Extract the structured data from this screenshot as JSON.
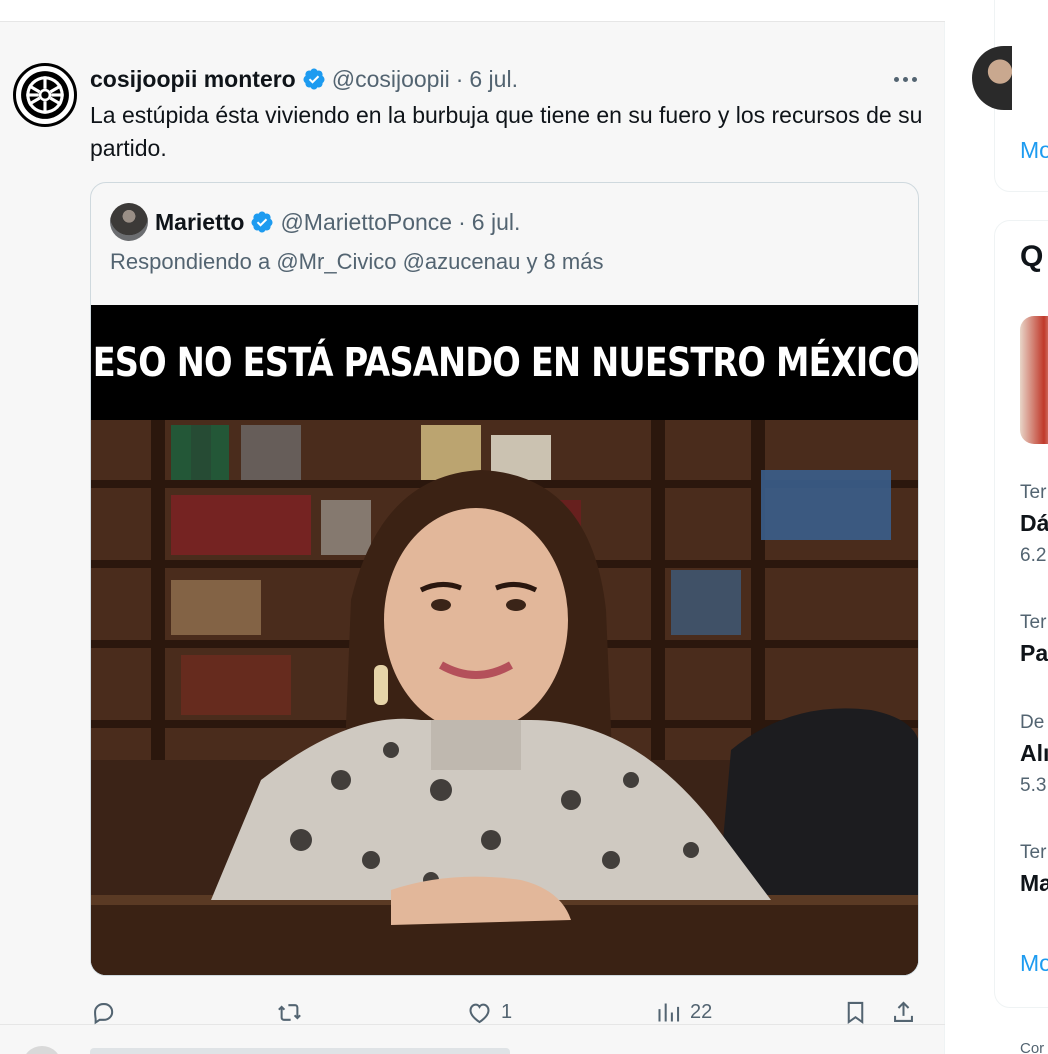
{
  "tweet": {
    "author_name": "cosijoopii montero",
    "author_handle": "@cosijoopii",
    "separator": "·",
    "date": "6 jul.",
    "text": "La estúpida ésta  viviendo en la burbuja que tiene en su fuero y los recursos de su partido."
  },
  "quote": {
    "author_name": "Marietto",
    "author_handle": "@MariettoPonce",
    "separator": "·",
    "date": "6 jul.",
    "reply_to": "Respondiendo a @Mr_Civico @azucenau y 8 más",
    "image_caption": "ESO NO ESTÁ PASANDO EN NUESTRO MÉXICO"
  },
  "actions": {
    "replies": "",
    "reposts": "",
    "likes": "1",
    "views": "22"
  },
  "sidebar": {
    "more_label_1": "Mo",
    "section_title": "Q",
    "trends": [
      {
        "meta": "Ter",
        "title": "Dá",
        "posts": "6.2"
      },
      {
        "meta": "Ter",
        "title": "Pa",
        "posts": ""
      },
      {
        "meta": "De",
        "title": "Alı",
        "posts": "5.3"
      },
      {
        "meta": "Ter",
        "title": "Ma",
        "posts": ""
      }
    ],
    "more_label_2": "Mo",
    "footer": "Cor"
  },
  "colors": {
    "accent": "#1d9bf0",
    "secondary_text": "#536471",
    "primary_text": "#0f1419"
  }
}
